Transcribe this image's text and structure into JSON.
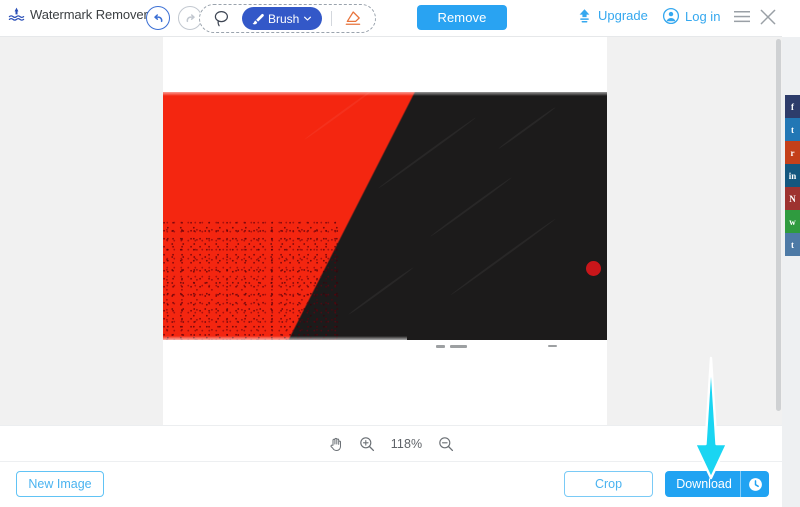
{
  "app": {
    "title": "Watermark Remover",
    "logo_icon": "watermark-logo-icon"
  },
  "toolbar": {
    "undo_icon": "undo-arrow-icon",
    "redo_icon": "redo-arrow-icon",
    "lasso_label": "Lasso",
    "lasso_icon": "lasso-icon",
    "brush_label": "Brush",
    "brush_icon": "brush-icon",
    "brush_caret_icon": "chevron-down-icon",
    "eraser_label": "Eraser",
    "eraser_icon": "eraser-icon",
    "remove_label": "Remove",
    "upgrade_label": "Upgrade",
    "upgrade_icon": "upload-arrow-icon",
    "login_label": "Log in",
    "login_icon": "user-circle-icon",
    "menu_icon": "hamburger-menu-icon",
    "close_icon": "close-x-icon"
  },
  "zoombar": {
    "pan_icon": "hand-pan-icon",
    "zoom_in_icon": "zoom-in-icon",
    "zoom_out_icon": "zoom-out-icon",
    "zoom_level": "118%"
  },
  "bottombar": {
    "new_image_label": "New Image",
    "crop_label": "Crop",
    "download_label": "Download",
    "download_extra_icon": "clock-icon"
  },
  "canvas": {
    "image_alt": "red-and-black-abstract-photo",
    "brush_mark": "red-brush-dot"
  },
  "social": {
    "items": [
      {
        "name": "facebook",
        "glyph": "f",
        "color": "#2d3c6b"
      },
      {
        "name": "twitter",
        "glyph": "t",
        "color": "#2277b5"
      },
      {
        "name": "reddit",
        "glyph": "r",
        "color": "#c4401a"
      },
      {
        "name": "linkedin",
        "glyph": "in",
        "color": "#14577f"
      },
      {
        "name": "pinterest",
        "glyph": "N",
        "color": "#9e3330"
      },
      {
        "name": "whatsapp",
        "glyph": "w",
        "color": "#2f9b3f"
      },
      {
        "name": "tumblr",
        "glyph": "t",
        "color": "#4d7aa6"
      }
    ]
  },
  "annotation": {
    "arrow_icon": "cyan-down-arrow-icon",
    "arrow_color": "#1ad5f2",
    "points_to": "Download"
  },
  "colors": {
    "primary_blue": "#29a3f2",
    "brush_blue": "#3358c8",
    "link_blue": "#35a8ef",
    "photo_red": "#f42610",
    "photo_black": "#1c1b1b",
    "workspace_bg": "#f1f1f1"
  }
}
